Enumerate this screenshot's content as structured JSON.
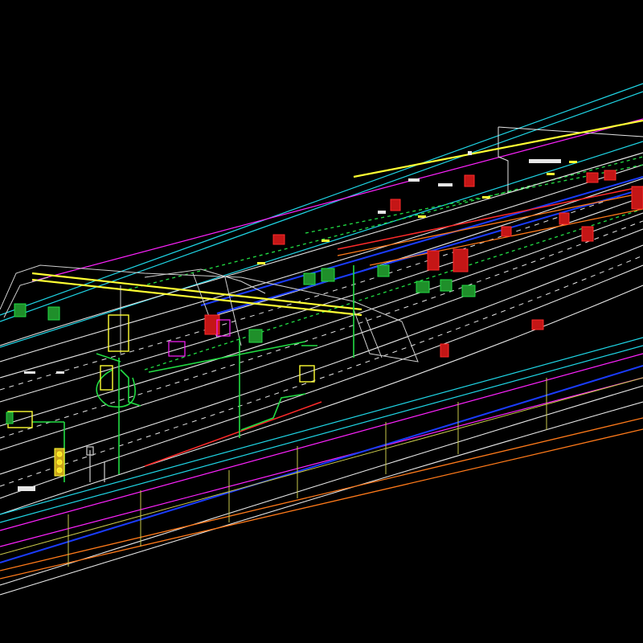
{
  "drawing": {
    "background": "#000000",
    "layer_colors": {
      "carriageway": "#e6e6e6",
      "boundary": "#1fd6e6",
      "median": "#ff22ff",
      "traffic_lane": "#1a3cff",
      "utility": "#ff7a1a",
      "kerb": "#c9c94a",
      "gantry": "#ffff33",
      "structure": "#22dd44",
      "signage": "#ff2a2a",
      "gantry_steel": "#cfcfcf"
    },
    "icons": [
      "gantry-icon",
      "traffic-signal-icon",
      "sign-panel-icon",
      "lamp-post-icon"
    ]
  }
}
